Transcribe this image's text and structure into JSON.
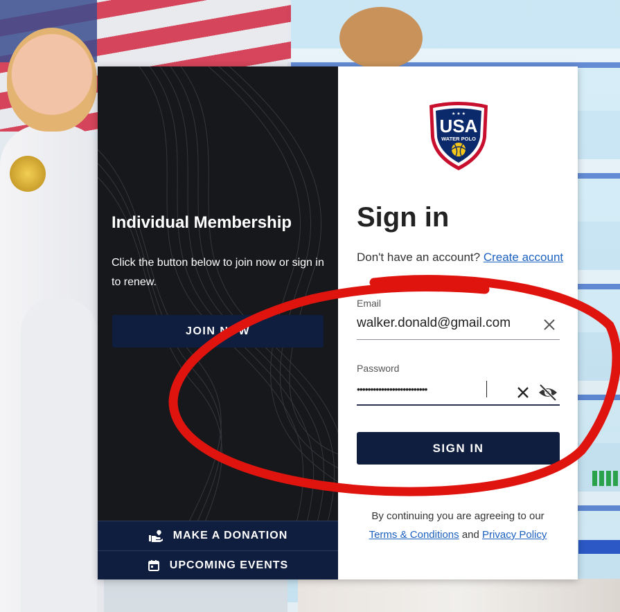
{
  "left_panel": {
    "title": "Individual Membership",
    "description": "Click the button below to join now or sign in to renew.",
    "join_label": "JOIN NOW",
    "donate_label": "MAKE A DONATION",
    "events_label": "UPCOMING EVENTS"
  },
  "logo": {
    "text_main": "USA",
    "text_sub": "WATER POLO"
  },
  "signin": {
    "title": "Sign in",
    "no_account_text": "Don't have an account?",
    "create_account_link": "Create account",
    "email_label": "Email",
    "email_value": "walker.donald@gmail.com",
    "password_label": "Password",
    "password_value": "••••••••••••••••••••••••••",
    "button_label": "SIGN IN",
    "terms_prefix": "By continuing you are agreeing to our",
    "terms_link": "Terms & Conditions",
    "terms_and": "and",
    "privacy_link": "Privacy Policy"
  },
  "colors": {
    "navy": "#0f1d3e",
    "link": "#1c61c0",
    "annotation_red": "#e0140f"
  }
}
